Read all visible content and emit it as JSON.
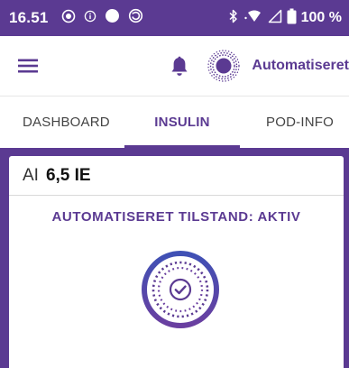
{
  "status_bar": {
    "time": "16.51",
    "battery": "100 %"
  },
  "app_bar": {
    "title": "Automatiseret"
  },
  "tabs": [
    {
      "label": "DASHBOARD",
      "active": false
    },
    {
      "label": "INSULIN",
      "active": true
    },
    {
      "label": "POD-INFO",
      "active": false
    }
  ],
  "card": {
    "ai_label": "AI",
    "ai_value": "6,5 IE",
    "mode_text": "AUTOMATISERET TILSTAND: AKTIV"
  },
  "colors": {
    "brand_purple": "#5b3a92",
    "emblem_blue": "#3f51b5",
    "white": "#ffffff"
  },
  "icons": [
    "record-icon",
    "info-circle-icon",
    "filled-circle-icon",
    "sync-icon",
    "bluetooth-icon",
    "wifi-icon",
    "signal-icon",
    "battery-icon",
    "menu-icon",
    "bell-icon",
    "automated-mode-icon",
    "check-icon"
  ]
}
